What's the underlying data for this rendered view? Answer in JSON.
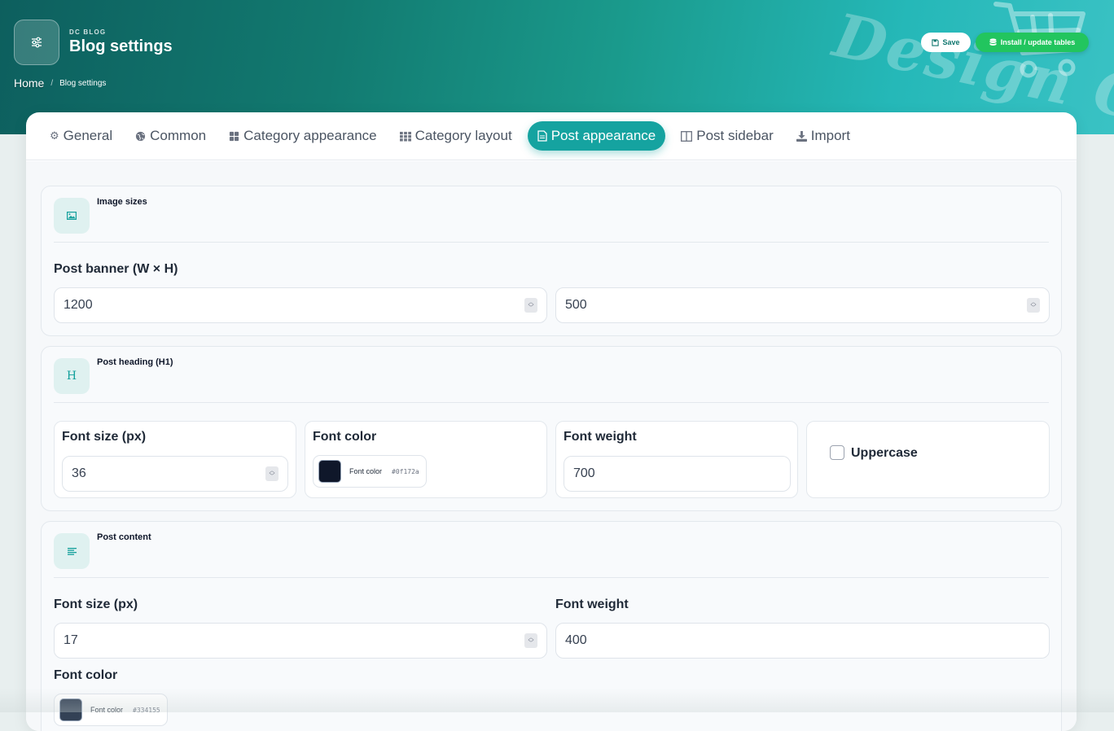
{
  "header": {
    "eyebrow": "DC BLOG",
    "title": "Blog settings",
    "watermark": "Design C",
    "breadcrumb": {
      "home": "Home",
      "separator": "/",
      "current": "Blog settings"
    },
    "save_label": "Save",
    "install_label": "Install / update tables"
  },
  "tabs": [
    {
      "label": "General",
      "icon": "gear-icon",
      "active": false
    },
    {
      "label": "Common",
      "icon": "globe-icon",
      "active": false
    },
    {
      "label": "Category appearance",
      "icon": "grid-icon",
      "active": false
    },
    {
      "label": "Category layout",
      "icon": "th-icon",
      "active": false
    },
    {
      "label": "Post appearance",
      "icon": "document-icon",
      "active": true
    },
    {
      "label": "Post sidebar",
      "icon": "columns-icon",
      "active": false
    },
    {
      "label": "Import",
      "icon": "download-icon",
      "active": false
    }
  ],
  "sections": {
    "image_sizes": {
      "title": "Image sizes",
      "icon": "image-icon",
      "banner_label": "Post banner (W × H)",
      "width": "1200",
      "height": "500"
    },
    "post_heading": {
      "title": "Post heading (H1)",
      "icon_text": "H",
      "font_size_label": "Font size (px)",
      "font_size": "36",
      "font_color_label": "Font color",
      "font_color_chip_label": "Font color",
      "font_color_hex": "#0f172a",
      "font_weight_label": "Font weight",
      "font_weight": "700",
      "uppercase_label": "Uppercase",
      "uppercase_checked": false
    },
    "post_content": {
      "title": "Post content",
      "icon": "align-left-icon",
      "font_size_label": "Font size (px)",
      "font_size": "17",
      "font_weight_label": "Font weight",
      "font_weight": "400",
      "font_color_label": "Font color",
      "font_color_chip_label": "Font color",
      "font_color_hex": "#334155"
    }
  },
  "colors": {
    "accent": "#15a3a0",
    "install_button": "#22c55e",
    "heading_color": "#0f172a",
    "content_color": "#334155"
  }
}
